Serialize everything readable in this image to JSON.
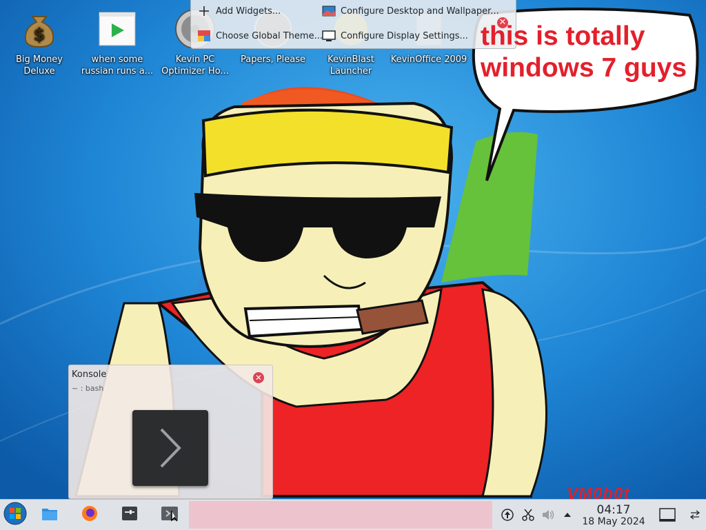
{
  "desktop_icons": [
    {
      "label": "Big Money Deluxe",
      "icon": "money-bag-icon"
    },
    {
      "label": "when some russian runs a...",
      "icon": "video-player-icon"
    },
    {
      "label": "Kevin PC Optimizer Ho...",
      "icon": "optimizer-disc-icon"
    },
    {
      "label": "Papers, Please",
      "icon": "papers-please-icon"
    },
    {
      "label": "KevinBlast Launcher",
      "icon": "launcher-icon"
    },
    {
      "label": "KevinOffice 2009",
      "icon": "office-icon"
    }
  ],
  "desktop_menu": {
    "add_widgets": "Add Widgets...",
    "choose_global_theme": "Choose Global Theme...",
    "configure_wallpaper": "Configure Desktop and Wallpaper...",
    "configure_display": "Configure Display Settings..."
  },
  "speech_bubble": {
    "line1": "this is totally",
    "line2": "windows 7 guys"
  },
  "konsole_tooltip": {
    "title": "Konsole",
    "subtitle": "~ : bash"
  },
  "taskbar": {
    "start_icon": "start-orb-icon",
    "pinned": [
      "file-manager-icon",
      "firefox-icon",
      "system-settings-icon",
      "konsole-icon"
    ],
    "tray": [
      "updates-icon",
      "clipboard-scissors-icon",
      "volume-icon",
      "expand-tray-chevron-icon"
    ],
    "clock_time": "04:17",
    "clock_date": "18 May 2024"
  },
  "watermark": "VM0b0t",
  "colors": {
    "wallpaper_blue": "#1a7fd0",
    "accent_red": "#e3202c",
    "taskbar_bg": "#dfe3e7"
  }
}
